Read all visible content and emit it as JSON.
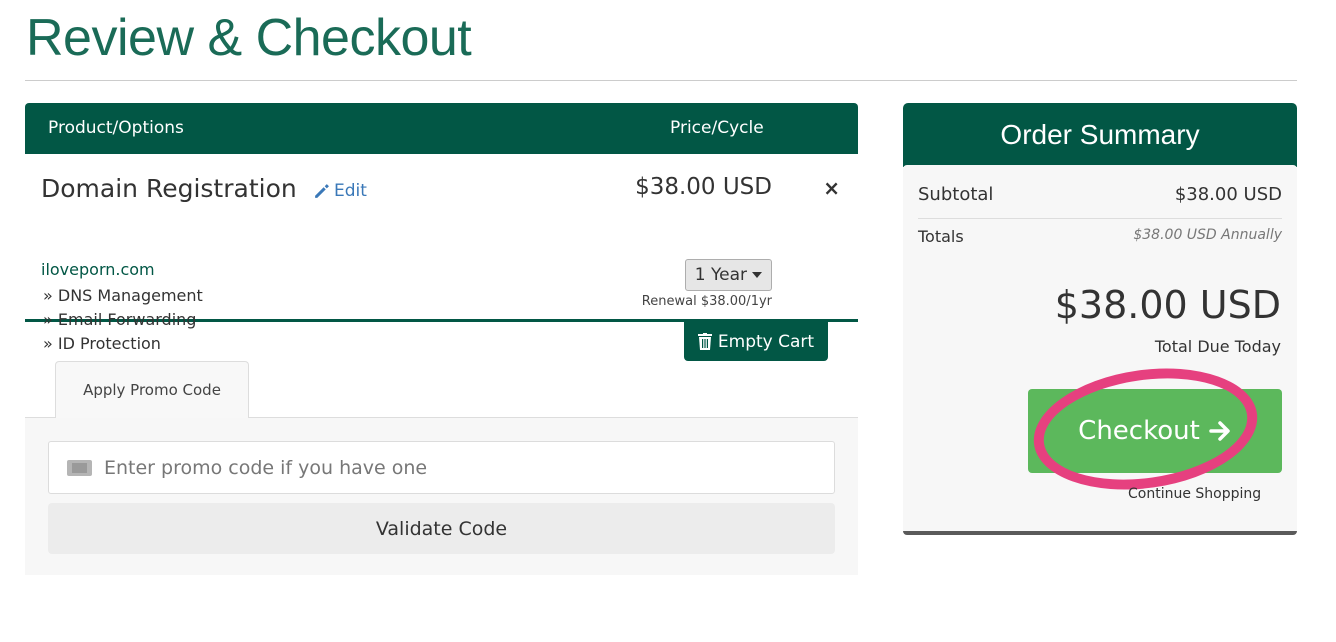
{
  "page": {
    "title": "Review & Checkout"
  },
  "cart": {
    "headers": {
      "product": "Product/Options",
      "price": "Price/Cycle"
    },
    "item": {
      "name": "Domain Registration",
      "edit_label": "Edit",
      "domain": "iloveporn.com",
      "addons": [
        "» DNS Management",
        "» Email Forwarding",
        "» ID Protection"
      ],
      "price": "$38.00 USD",
      "cycle": "1 Year",
      "renewal": "Renewal $38.00/1yr",
      "remove_icon": "×"
    },
    "empty_cart_label": "Empty Cart"
  },
  "promo": {
    "tab_label": "Apply Promo Code",
    "input_placeholder": "Enter promo code if you have one",
    "input_value": "",
    "validate_label": "Validate Code"
  },
  "summary": {
    "title": "Order Summary",
    "subtotal_label": "Subtotal",
    "subtotal_value": "$38.00 USD",
    "totals_label": "Totals",
    "totals_value": "$38.00 USD Annually",
    "total_due": "$38.00 USD",
    "total_due_label": "Total Due Today",
    "checkout_label": "Checkout",
    "continue_label": "Continue Shopping"
  },
  "colors": {
    "brand": "#025745",
    "title": "#1a6b57",
    "checkout": "#5cb85c",
    "annotation": "#e6407f",
    "link": "#3a78b8"
  }
}
